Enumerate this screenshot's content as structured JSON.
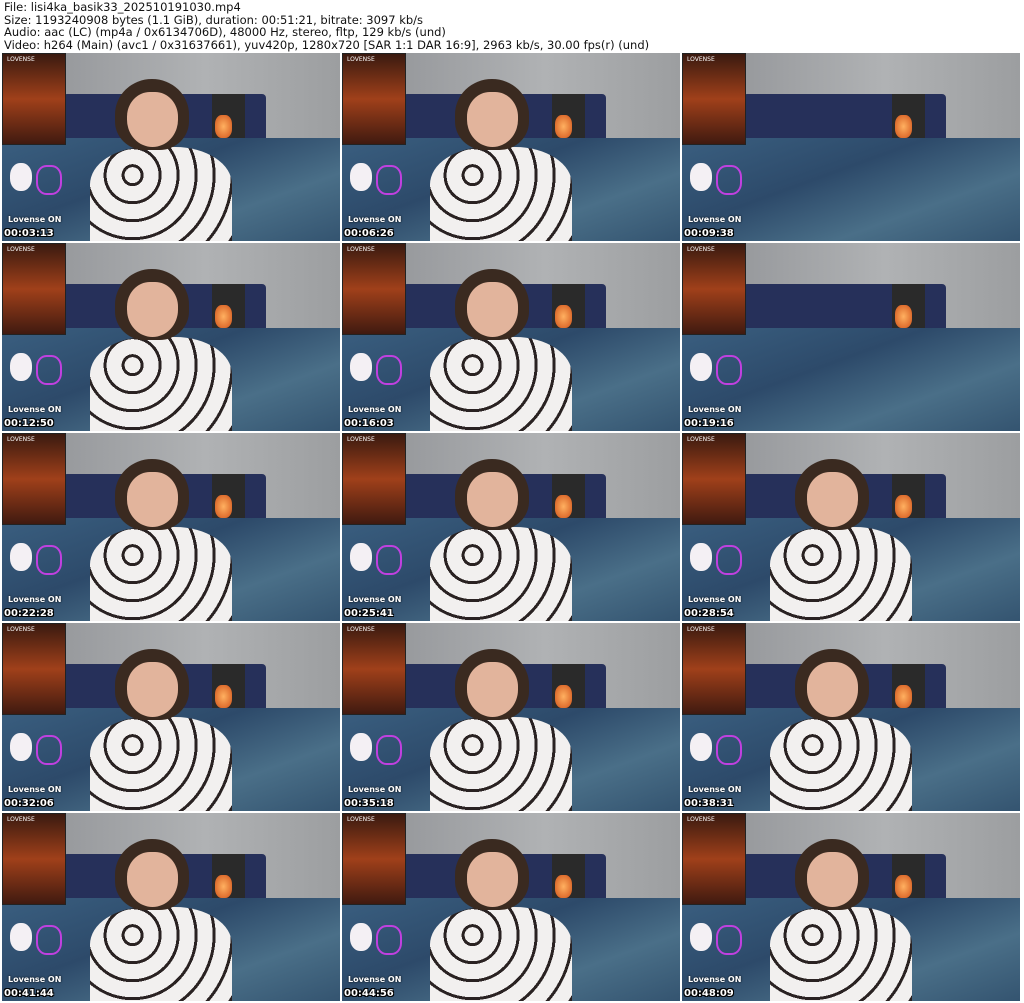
{
  "header": {
    "file": "File: lisi4ka_basik33_202510191030.mp4",
    "size": "Size: 1193240908 bytes (1.1 GiB), duration: 00:51:21, bitrate: 3097 kb/s",
    "audio": "Audio: aac (LC) (mp4a / 0x6134706D), 48000 Hz, stereo, fltp, 129 kb/s (und)",
    "video": "Video: h264 (Main) (avc1 / 0x31637661), yuv420p, 1280x720 [SAR 1:1 DAR 16:9], 2963 kb/s, 30.00 fps(r) (und)"
  },
  "overlay": {
    "brand": "LOVENSE",
    "status": "Lovense ON"
  },
  "thumbnails": [
    {
      "timestamp": "00:03:13",
      "person": true
    },
    {
      "timestamp": "00:06:26",
      "person": true
    },
    {
      "timestamp": "00:09:38",
      "person": false
    },
    {
      "timestamp": "00:12:50",
      "person": true
    },
    {
      "timestamp": "00:16:03",
      "person": true
    },
    {
      "timestamp": "00:19:16",
      "person": false
    },
    {
      "timestamp": "00:22:28",
      "person": true
    },
    {
      "timestamp": "00:25:41",
      "person": true
    },
    {
      "timestamp": "00:28:54",
      "person": true
    },
    {
      "timestamp": "00:32:06",
      "person": true
    },
    {
      "timestamp": "00:35:18",
      "person": true
    },
    {
      "timestamp": "00:38:31",
      "person": true
    },
    {
      "timestamp": "00:41:44",
      "person": true
    },
    {
      "timestamp": "00:44:56",
      "person": true
    },
    {
      "timestamp": "00:48:09",
      "person": true
    }
  ]
}
